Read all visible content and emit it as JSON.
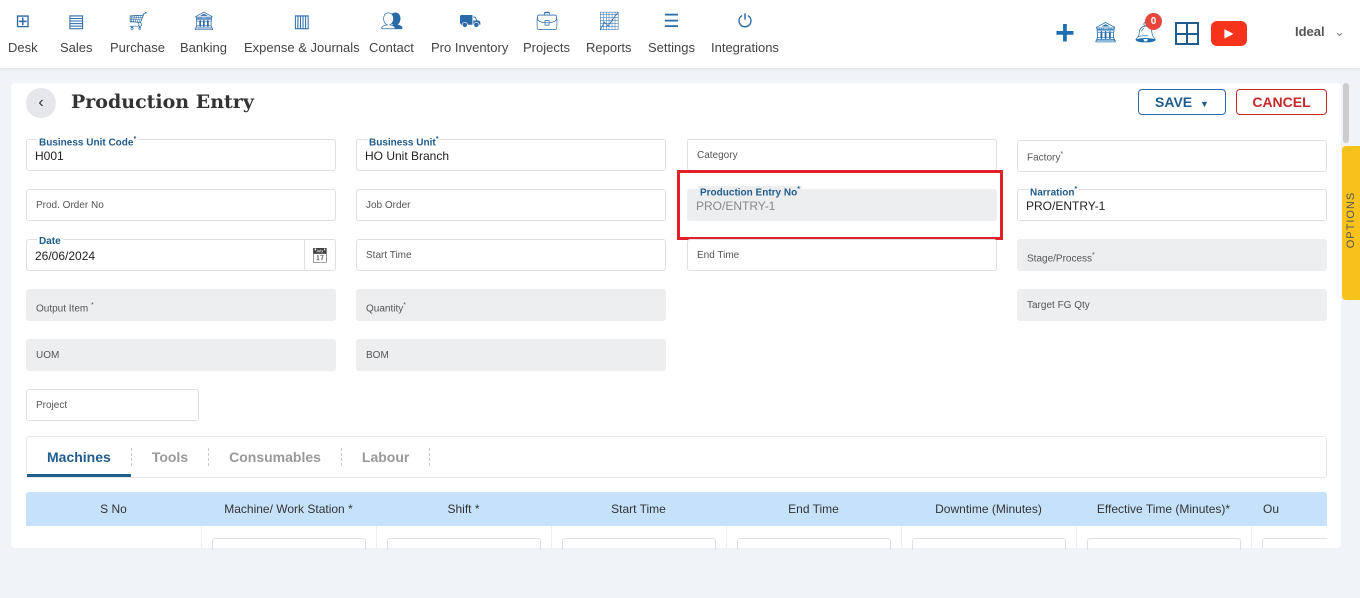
{
  "nav": [
    {
      "label": "Desk",
      "icon": "desk-icon"
    },
    {
      "label": "Sales",
      "icon": "sales-icon"
    },
    {
      "label": "Purchase",
      "icon": "cart-icon"
    },
    {
      "label": "Banking",
      "icon": "bank-icon"
    },
    {
      "label": "Expense & Journals",
      "icon": "journal-icon"
    },
    {
      "label": "Contact",
      "icon": "contact-icon"
    },
    {
      "label": "Pro Inventory",
      "icon": "inventory-icon"
    },
    {
      "label": "Projects",
      "icon": "projects-icon"
    },
    {
      "label": "Reports",
      "icon": "reports-icon"
    },
    {
      "label": "Settings",
      "icon": "settings-icon"
    },
    {
      "label": "Integrations",
      "icon": "integrations-icon"
    }
  ],
  "header": {
    "notification_count": "0",
    "user": "Ideal",
    "accent": "#1f6fb0",
    "youtube_color": "#f7331c"
  },
  "page": {
    "title": "Production Entry",
    "save": "SAVE",
    "cancel": "CANCEL",
    "options": "OPTIONS"
  },
  "fields": {
    "bu_code": {
      "label": "Business Unit Code",
      "value": "H001"
    },
    "bu": {
      "label": "Business Unit",
      "value": "HO Unit Branch"
    },
    "category": {
      "label": "Category"
    },
    "factory": {
      "label": "Factory"
    },
    "prod_order": {
      "label": "Prod. Order No"
    },
    "job_order": {
      "label": "Job Order"
    },
    "entry_no": {
      "label": "Production Entry No",
      "value": "PRO/ENTRY-1"
    },
    "narration": {
      "label": "Narration",
      "value": "PRO/ENTRY-1"
    },
    "date": {
      "label": "Date",
      "value": "26/06/2024"
    },
    "start": {
      "label": "Start Time"
    },
    "end": {
      "label": "End Time"
    },
    "stage": {
      "label": "Stage/Process"
    },
    "output": {
      "label": "Output Item "
    },
    "qty": {
      "label": "Quantity"
    },
    "target": {
      "label": "Target FG Qty"
    },
    "uom": {
      "label": "UOM"
    },
    "bom": {
      "label": "BOM"
    },
    "project": {
      "label": "Project"
    }
  },
  "tabs": [
    "Machines",
    "Tools",
    "Consumables",
    "Labour"
  ],
  "table": {
    "columns": [
      "S No",
      "Machine/ Work Station *",
      "Shift *",
      "Start Time",
      "End Time",
      "Downtime (Minutes)",
      "Effective Time (Minutes)*",
      "Ou"
    ]
  }
}
